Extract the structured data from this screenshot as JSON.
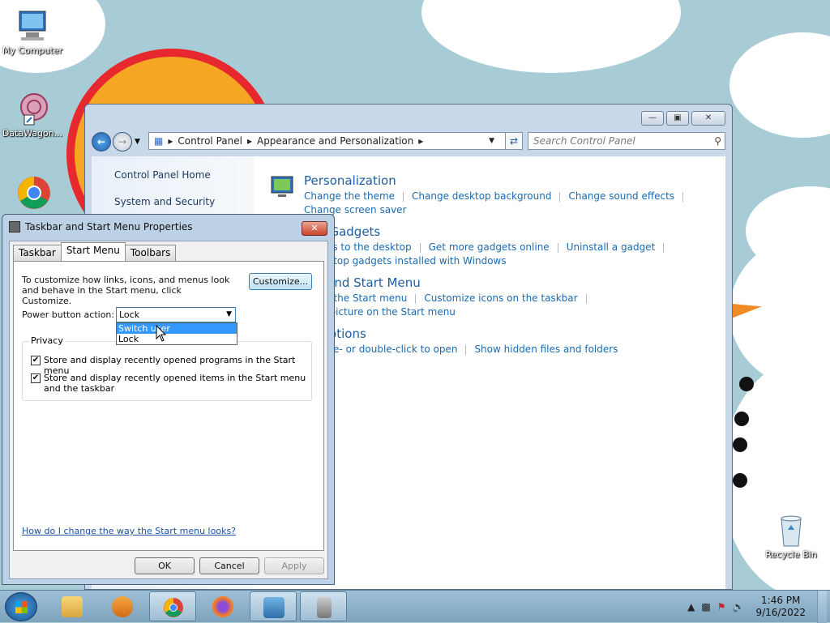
{
  "desktop": {
    "icons": [
      {
        "label": "My Computer",
        "icon": "computer-icon"
      },
      {
        "label": "DataWagon...",
        "icon": "datawagon-icon"
      },
      {
        "label": "Recycle Bin",
        "icon": "recycle-bin-icon"
      }
    ]
  },
  "control_panel": {
    "address": [
      "Control Panel",
      "Appearance and Personalization"
    ],
    "search_placeholder": "Search Control Panel",
    "left_nav": [
      "Control Panel Home",
      "System and Security"
    ],
    "categories": [
      {
        "title": "Personalization",
        "links": [
          "Change the theme",
          "Change desktop background",
          "Change sound effects"
        ],
        "links2": [
          "Change screen saver"
        ]
      },
      {
        "title": "op Gadgets",
        "links": [
          "dgets to the desktop",
          "Get more gadgets online",
          "Uninstall a gadget"
        ],
        "links2": [
          "desktop gadgets installed with Windows"
        ]
      },
      {
        "title": "ar and Start Menu",
        "links": [
          "nize the Start menu",
          "Customize icons on the taskbar"
        ],
        "links2": [
          "the picture on the Start menu"
        ]
      },
      {
        "title": "r Options",
        "links": [
          "single- or double-click to open",
          "Show hidden files and folders"
        ],
        "links2": []
      }
    ]
  },
  "dialog": {
    "title": "Taskbar and Start Menu Properties",
    "tabs": [
      "Taskbar",
      "Start Menu",
      "Toolbars"
    ],
    "active_tab": "Start Menu",
    "description": "To customize how links, icons, and menus look and behave in the Start menu, click Customize.",
    "customize_label": "Customize...",
    "power_label": "Power button action:",
    "power_value": "Lock",
    "power_options": [
      "Switch user",
      "Lock"
    ],
    "highlighted_option": "Switch user",
    "privacy_label": "Privacy",
    "check1": "Store and display recently opened programs in the Start menu",
    "check2": "Store and display recently opened items in the Start menu and the taskbar",
    "help_link": "How do I change the way the Start menu looks?",
    "ok": "OK",
    "cancel": "Cancel",
    "apply": "Apply"
  },
  "taskbar": {
    "time": "1:46 PM",
    "date": "9/16/2022"
  },
  "colors": {
    "link": "#1b6ab0",
    "heading": "#1e5e9e",
    "selection": "#3399ff"
  }
}
